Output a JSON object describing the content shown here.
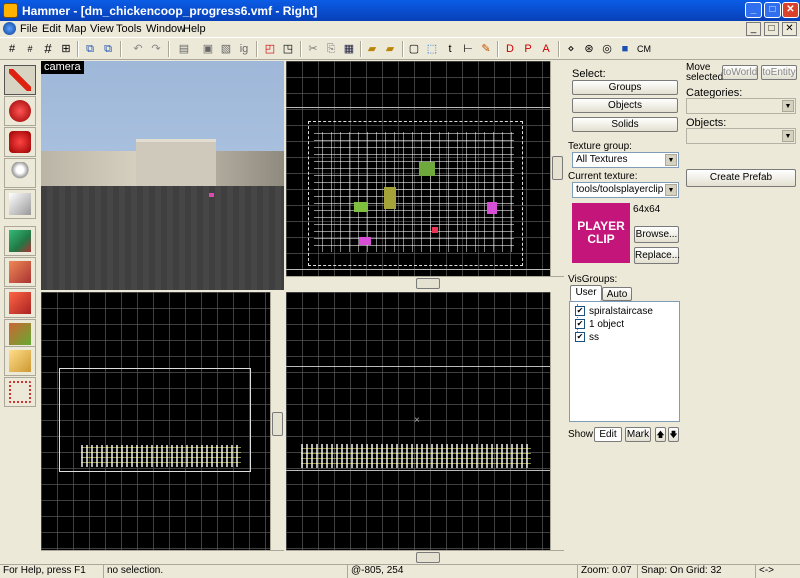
{
  "window": {
    "title": "Hammer - [dm_chickencoop_progress6.vmf - Right]",
    "min": "_",
    "max": "□",
    "close": "✕"
  },
  "menu": [
    "File",
    "Edit",
    "Map",
    "View",
    "Tools",
    "Window",
    "Help"
  ],
  "mdi": {
    "min": "_",
    "restore": "□",
    "close": "✕"
  },
  "toolbar_icons": [
    "grid-icon",
    "grid-small-icon",
    "grid-large-icon",
    "grid-toggle-icon",
    "group-icon",
    "ungroup-icon",
    "undo-icon",
    "redo-icon",
    "carve-icon",
    "make-hollow-icon",
    "group-selection-icon",
    "ungroup-selection-icon",
    "ignore-group-icon",
    "hide-icon",
    "unhide-icon",
    "cut-icon",
    "copy-icon",
    "paste-icon",
    "texture-lock-icon",
    "texture-lock-scale-icon",
    "selection-box-icon",
    "select-by-handle-icon",
    "editor-icon",
    "flip-icon",
    "vmf-icon",
    "run-map-icon",
    "render-icon",
    "cordon-icon",
    "ruler-icon",
    "camera-icon",
    "cubemap-icon"
  ],
  "toolbar_cm": "CM",
  "viewports": {
    "camera_label": "camera"
  },
  "select": {
    "label": "Select:",
    "groups": "Groups",
    "objects": "Objects",
    "solids": "Solids"
  },
  "move": {
    "label_line1": "Move",
    "label_line2": "selected:",
    "toworld": "toWorld",
    "toentity": "toEntity"
  },
  "categories": {
    "label": "Categories:"
  },
  "objects": {
    "label": "Objects:"
  },
  "create_prefab": "Create Prefab",
  "texture": {
    "group_label": "Texture group:",
    "group_value": "All Textures",
    "current_label": "Current texture:",
    "current_value": "tools/toolsplayerclip",
    "preview_text_1": "PLAYER",
    "preview_text_2": "CLIP",
    "size": "64x64",
    "browse": "Browse...",
    "replace": "Replace..."
  },
  "visgroups": {
    "label": "VisGroups:",
    "tab_user": "User",
    "tab_auto": "Auto",
    "items": [
      "spiralstaircase",
      "1 object",
      "ss"
    ],
    "show": "Show",
    "edit": "Edit",
    "mark": "Mark",
    "up": "🡅",
    "down": "🡇"
  },
  "status": {
    "help": "For Help, press F1",
    "selection": "no selection.",
    "coords": "@-805, 254",
    "zoom": "Zoom: 0.07",
    "snap": "Snap: On Grid: 32",
    "arrows": "<->"
  },
  "colors": {
    "accent": "#0a5ce6",
    "texture_preview": "#c4167a",
    "grid_line": "#5a5a5a",
    "geometry": "#e8e8e8"
  }
}
